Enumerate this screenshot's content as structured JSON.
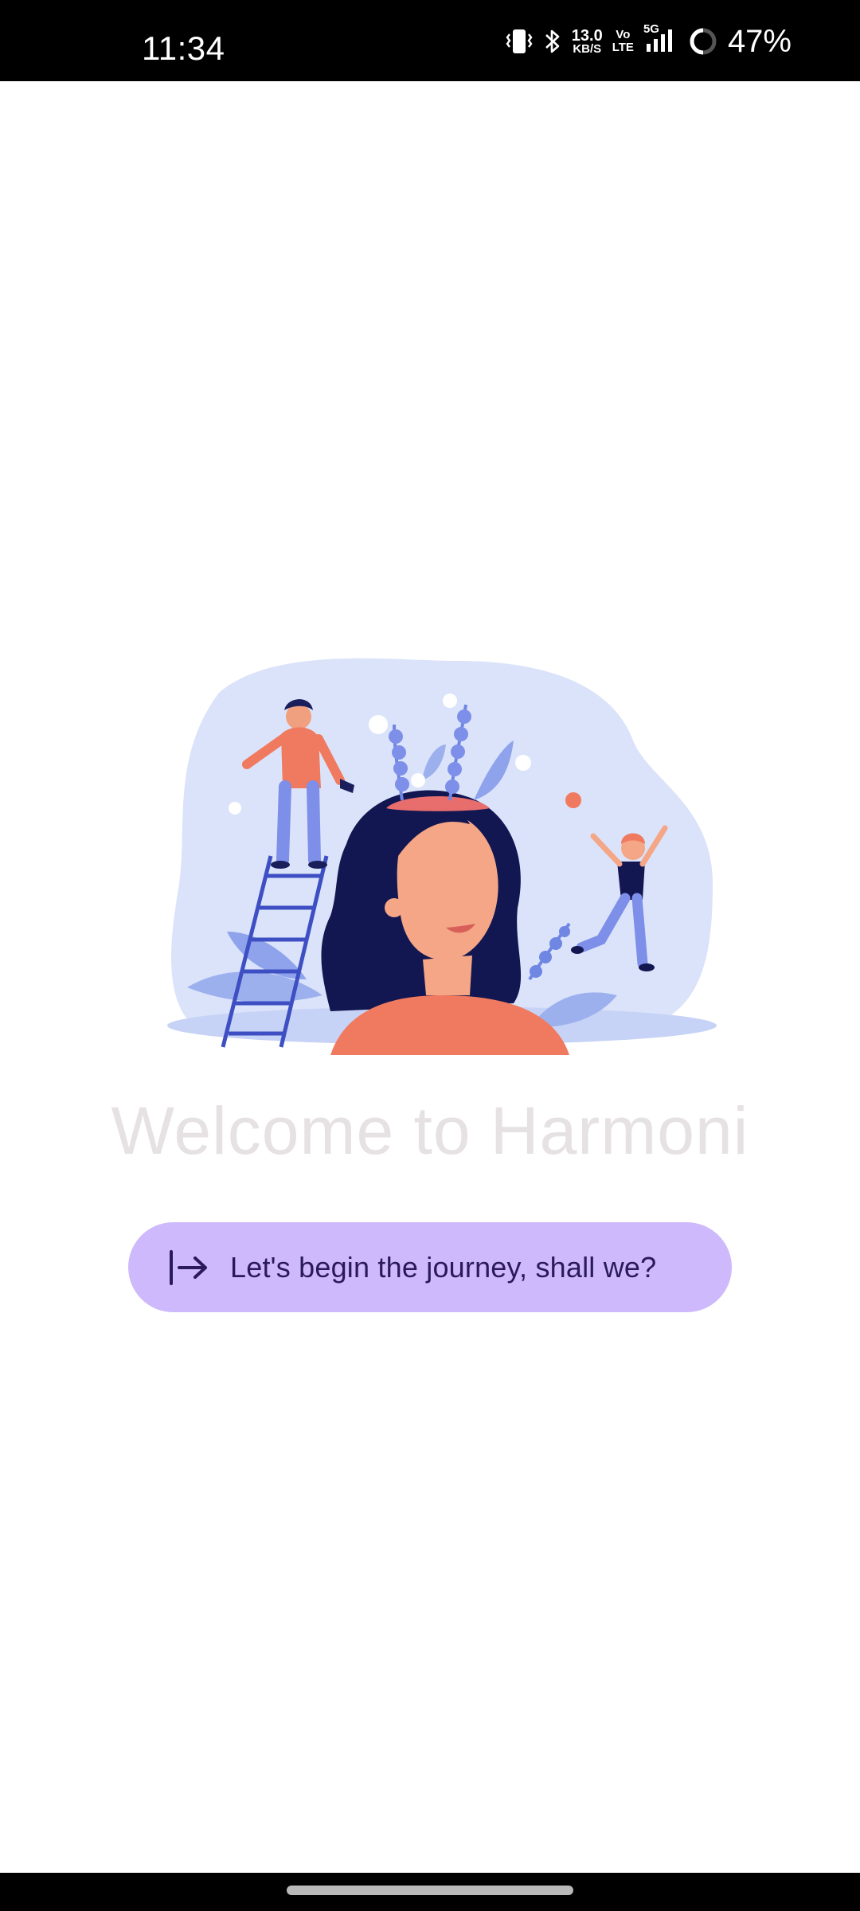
{
  "status_bar": {
    "time": "11:34",
    "net_speed_value": "13.0",
    "net_speed_unit": "KB/S",
    "volte_top": "Vo",
    "volte_bottom": "LTE",
    "signal_label": "5G",
    "battery_percent": "47%",
    "icons": [
      "vibrate-icon",
      "bluetooth-icon",
      "signal-icon",
      "battery-ring-icon"
    ]
  },
  "main": {
    "illustration_icon": "mind-garden-illustration",
    "welcome_title": "Welcome to Harmoni",
    "begin_button": {
      "label": "Let's begin the journey, shall we?",
      "icon": "login-arrow-icon"
    }
  },
  "colors": {
    "status_bar_bg": "#000000",
    "title_text": "#e6e1e3",
    "button_bg": "#cdb9fb",
    "button_text": "#2a1a5c"
  }
}
